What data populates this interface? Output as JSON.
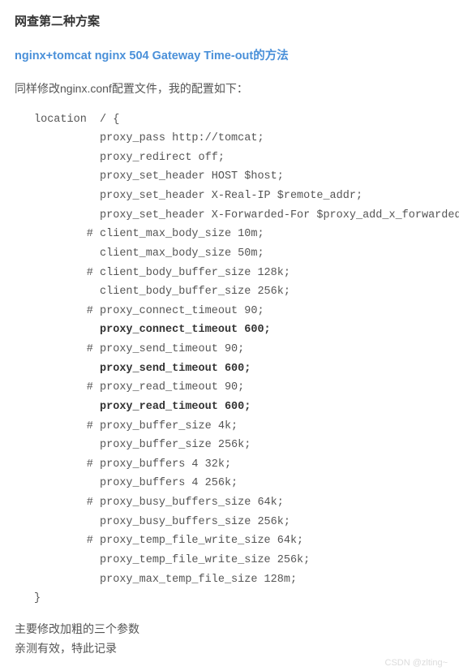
{
  "heading": "网查第二种方案",
  "link_text": "nginx+tomcat nginx 504 Gateway Time-out的方法",
  "intro": "同样修改nginx.conf配置文件，我的配置如下：",
  "code_lines": [
    {
      "indent": 0,
      "text": "location  / {",
      "bold": false
    },
    {
      "indent": 2,
      "text": "proxy_pass http://tomcat;",
      "bold": false
    },
    {
      "indent": 2,
      "text": "proxy_redirect off;",
      "bold": false
    },
    {
      "indent": 2,
      "text": "proxy_set_header HOST $host;",
      "bold": false
    },
    {
      "indent": 2,
      "text": "proxy_set_header X-Real-IP $remote_addr;",
      "bold": false
    },
    {
      "indent": 2,
      "text": "proxy_set_header X-Forwarded-For $proxy_add_x_forwarded_for;",
      "bold": false
    },
    {
      "indent": 1,
      "text": "# client_max_body_size 10m;",
      "bold": false
    },
    {
      "indent": 2,
      "text": "client_max_body_size 50m;",
      "bold": false
    },
    {
      "indent": 1,
      "text": "# client_body_buffer_size 128k;",
      "bold": false
    },
    {
      "indent": 2,
      "text": "client_body_buffer_size 256k;",
      "bold": false
    },
    {
      "indent": 1,
      "text": "# proxy_connect_timeout 90;",
      "bold": false
    },
    {
      "indent": 2,
      "text": "proxy_connect_timeout 600;",
      "bold": true
    },
    {
      "indent": 1,
      "text": "# proxy_send_timeout 90;",
      "bold": false
    },
    {
      "indent": 2,
      "text": "proxy_send_timeout 600;",
      "bold": true
    },
    {
      "indent": 1,
      "text": "# proxy_read_timeout 90;",
      "bold": false
    },
    {
      "indent": 2,
      "text": "proxy_read_timeout 600;",
      "bold": true
    },
    {
      "indent": 1,
      "text": "# proxy_buffer_size 4k;",
      "bold": false
    },
    {
      "indent": 2,
      "text": "proxy_buffer_size 256k;",
      "bold": false
    },
    {
      "indent": 1,
      "text": "# proxy_buffers 4 32k;",
      "bold": false
    },
    {
      "indent": 2,
      "text": "proxy_buffers 4 256k;",
      "bold": false
    },
    {
      "indent": 1,
      "text": "# proxy_busy_buffers_size 64k;",
      "bold": false
    },
    {
      "indent": 2,
      "text": "proxy_busy_buffers_size 256k;",
      "bold": false
    },
    {
      "indent": 1,
      "text": "# proxy_temp_file_write_size 64k;",
      "bold": false
    },
    {
      "indent": 2,
      "text": "proxy_temp_file_write_size 256k;",
      "bold": false
    },
    {
      "indent": 2,
      "text": "proxy_max_temp_file_size 128m;",
      "bold": false
    },
    {
      "indent": 0,
      "text": "}",
      "bold": false
    }
  ],
  "note1": "主要修改加粗的三个参数",
  "note2": "亲测有效，特此记录",
  "watermark": "CSDN @zlting~"
}
